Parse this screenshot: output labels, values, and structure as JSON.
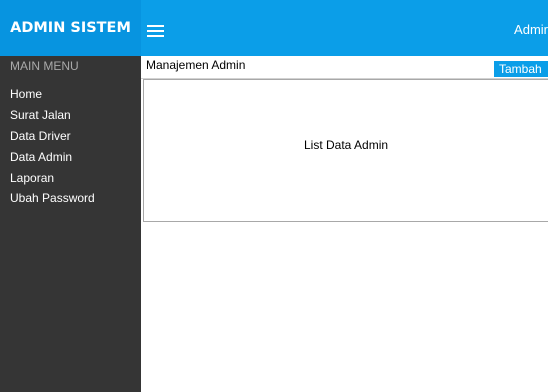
{
  "header": {
    "brand": "ADMIN SISTEM",
    "user_label": "Admir",
    "bg_color": "#0b9ee8"
  },
  "sidebar": {
    "title": "MAIN MENU",
    "items": [
      {
        "label": "Home"
      },
      {
        "label": "Surat Jalan"
      },
      {
        "label": "Data Driver"
      },
      {
        "label": "Data Admin"
      },
      {
        "label": "Laporan"
      },
      {
        "label": "Ubah Password"
      }
    ],
    "bg_color": "#353535"
  },
  "main": {
    "page_title": "Manajemen Admin",
    "add_button_label": "Tambah",
    "list_placeholder": "List Data Admin"
  },
  "icons": {
    "menu_toggle": "hamburger-icon"
  }
}
